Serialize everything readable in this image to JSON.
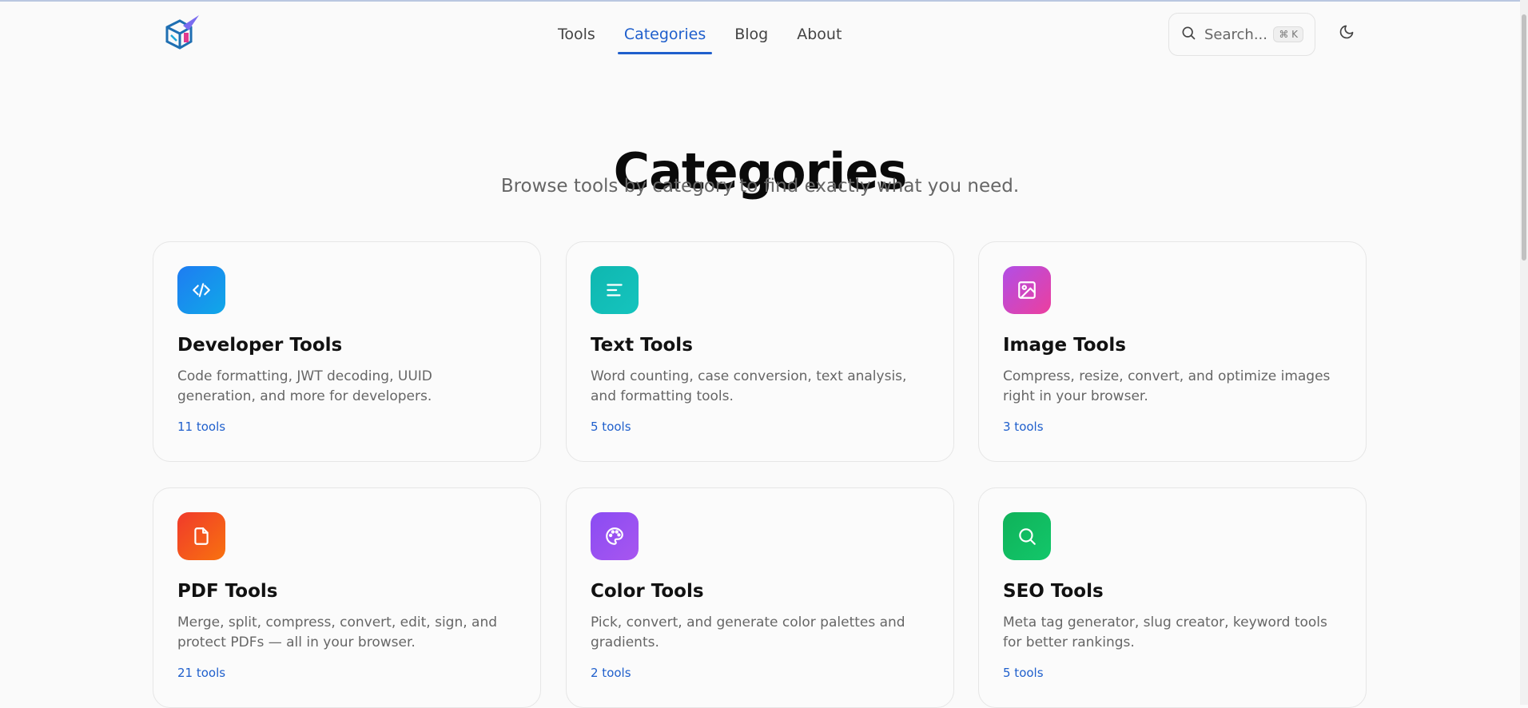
{
  "header": {
    "logo_name": "site-logo",
    "nav": [
      {
        "label": "Tools"
      },
      {
        "label": "Categories",
        "active": true
      },
      {
        "label": "Blog"
      },
      {
        "label": "About"
      }
    ],
    "search": {
      "placeholder": "Search...",
      "shortcut": "⌘ K"
    },
    "theme_icon": "moon-icon"
  },
  "main": {
    "title": "Categories",
    "subtitle": "Browse tools by category to find exactly what you need."
  },
  "categories": [
    {
      "name": "Developer Tools",
      "description": "Code formatting, JWT decoding, UUID generation, and more for developers.",
      "count": "11 tools",
      "icon": "code-icon",
      "colors": [
        "#1e7cf2",
        "#10a8e8"
      ]
    },
    {
      "name": "Text Tools",
      "description": "Word counting, case conversion, text analysis, and formatting tools.",
      "count": "5 tools",
      "icon": "text-align-icon",
      "colors": [
        "#0fb7b0",
        "#15c4be"
      ]
    },
    {
      "name": "Image Tools",
      "description": "Compress, resize, convert, and optimize images right in your browser.",
      "count": "3 tools",
      "icon": "image-icon",
      "colors": [
        "#b14ee6",
        "#ec3f9e"
      ]
    },
    {
      "name": "PDF Tools",
      "description": "Merge, split, compress, convert, edit, sign, and protect PDFs — all in your browser.",
      "count": "21 tools",
      "icon": "file-icon",
      "colors": [
        "#f03a2b",
        "#f8720f"
      ]
    },
    {
      "name": "Color Tools",
      "description": "Pick, convert, and generate color palettes and gradients.",
      "count": "2 tools",
      "icon": "palette-icon",
      "colors": [
        "#8a4cf2",
        "#a856f0"
      ]
    },
    {
      "name": "SEO Tools",
      "description": "Meta tag generator, slug creator, keyword tools for better rankings.",
      "count": "5 tools",
      "icon": "search-icon",
      "colors": [
        "#10b25a",
        "#12c76a"
      ]
    }
  ]
}
